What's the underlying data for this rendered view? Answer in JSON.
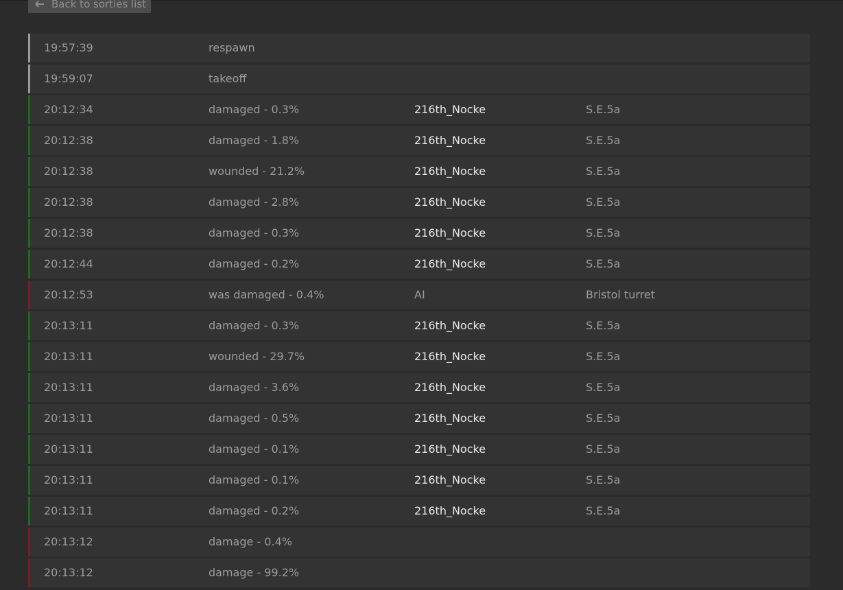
{
  "back_button": {
    "label": "Back to sorties list"
  },
  "colors": {
    "neutral": "#9a9a9a",
    "good": "#1e6b1e",
    "bad": "#7a1d24"
  },
  "events": [
    {
      "time": "19:57:39",
      "event": "respawn",
      "actor": "",
      "aircraft": "",
      "status": "neutral",
      "player": false
    },
    {
      "time": "19:59:07",
      "event": "takeoff",
      "actor": "",
      "aircraft": "",
      "status": "neutral",
      "player": false
    },
    {
      "time": "20:12:34",
      "event": "damaged - 0.3%",
      "actor": "216th_Nocke",
      "aircraft": "S.E.5a",
      "status": "good",
      "player": true
    },
    {
      "time": "20:12:38",
      "event": "damaged - 1.8%",
      "actor": "216th_Nocke",
      "aircraft": "S.E.5a",
      "status": "good",
      "player": true
    },
    {
      "time": "20:12:38",
      "event": "wounded - 21.2%",
      "actor": "216th_Nocke",
      "aircraft": "S.E.5a",
      "status": "good",
      "player": true
    },
    {
      "time": "20:12:38",
      "event": "damaged - 2.8%",
      "actor": "216th_Nocke",
      "aircraft": "S.E.5a",
      "status": "good",
      "player": true
    },
    {
      "time": "20:12:38",
      "event": "damaged - 0.3%",
      "actor": "216th_Nocke",
      "aircraft": "S.E.5a",
      "status": "good",
      "player": true
    },
    {
      "time": "20:12:44",
      "event": "damaged - 0.2%",
      "actor": "216th_Nocke",
      "aircraft": "S.E.5a",
      "status": "good",
      "player": true
    },
    {
      "time": "20:12:53",
      "event": "was damaged - 0.4%",
      "actor": "AI",
      "aircraft": "Bristol turret",
      "status": "bad",
      "player": false
    },
    {
      "time": "20:13:11",
      "event": "damaged - 0.3%",
      "actor": "216th_Nocke",
      "aircraft": "S.E.5a",
      "status": "good",
      "player": true
    },
    {
      "time": "20:13:11",
      "event": "wounded - 29.7%",
      "actor": "216th_Nocke",
      "aircraft": "S.E.5a",
      "status": "good",
      "player": true
    },
    {
      "time": "20:13:11",
      "event": "damaged - 3.6%",
      "actor": "216th_Nocke",
      "aircraft": "S.E.5a",
      "status": "good",
      "player": true
    },
    {
      "time": "20:13:11",
      "event": "damaged - 0.5%",
      "actor": "216th_Nocke",
      "aircraft": "S.E.5a",
      "status": "good",
      "player": true
    },
    {
      "time": "20:13:11",
      "event": "damaged - 0.1%",
      "actor": "216th_Nocke",
      "aircraft": "S.E.5a",
      "status": "good",
      "player": true
    },
    {
      "time": "20:13:11",
      "event": "damaged - 0.1%",
      "actor": "216th_Nocke",
      "aircraft": "S.E.5a",
      "status": "good",
      "player": true
    },
    {
      "time": "20:13:11",
      "event": "damaged - 0.2%",
      "actor": "216th_Nocke",
      "aircraft": "S.E.5a",
      "status": "good",
      "player": true
    },
    {
      "time": "20:13:12",
      "event": "damage - 0.4%",
      "actor": "",
      "aircraft": "",
      "status": "bad",
      "player": false
    },
    {
      "time": "20:13:12",
      "event": "damage - 99.2%",
      "actor": "",
      "aircraft": "",
      "status": "bad",
      "player": false
    }
  ]
}
